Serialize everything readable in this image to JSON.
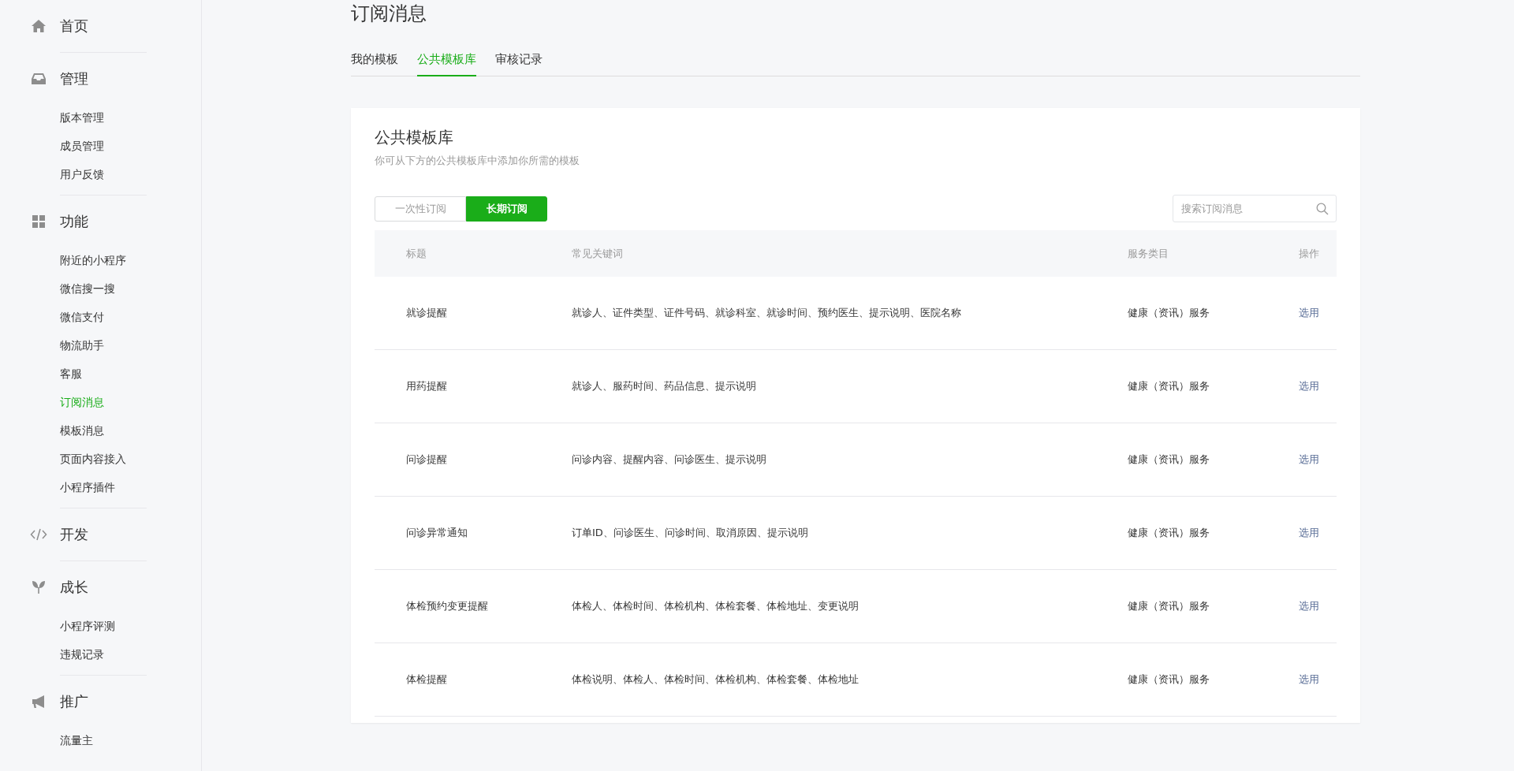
{
  "sidebar": {
    "sections": [
      {
        "title": "首页"
      },
      {
        "title": "管理",
        "items": [
          {
            "label": "版本管理",
            "selected": false
          },
          {
            "label": "成员管理",
            "selected": false
          },
          {
            "label": "用户反馈",
            "selected": false
          }
        ]
      },
      {
        "title": "功能",
        "items": [
          {
            "label": "附近的小程序",
            "selected": false
          },
          {
            "label": "微信搜一搜",
            "selected": false
          },
          {
            "label": "微信支付",
            "selected": false
          },
          {
            "label": "物流助手",
            "selected": false
          },
          {
            "label": "客服",
            "selected": false
          },
          {
            "label": "订阅消息",
            "selected": true
          },
          {
            "label": "模板消息",
            "selected": false
          },
          {
            "label": "页面内容接入",
            "selected": false
          },
          {
            "label": "小程序插件",
            "selected": false
          }
        ]
      },
      {
        "title": "开发"
      },
      {
        "title": "成长",
        "items": [
          {
            "label": "小程序评测",
            "selected": false
          },
          {
            "label": "违规记录",
            "selected": false
          }
        ]
      },
      {
        "title": "推广",
        "items": [
          {
            "label": "流量主",
            "selected": false
          }
        ]
      }
    ]
  },
  "page_title": "订阅消息",
  "tabs": [
    {
      "label": "我的模板",
      "selected": false
    },
    {
      "label": "公共模板库",
      "selected": true
    },
    {
      "label": "审核记录",
      "selected": false
    }
  ],
  "card": {
    "title": "公共模板库",
    "description": "你可从下方的公共模板库中添加你所需的模板",
    "segments": [
      {
        "label": "一次性订阅",
        "selected": false
      },
      {
        "label": "长期订阅",
        "selected": true
      }
    ],
    "search": {
      "placeholder": "搜索订阅消息"
    },
    "table": {
      "columns": [
        "标题",
        "常见关键词",
        "服务类目",
        "操作"
      ],
      "rows": [
        {
          "title": "就诊提醒",
          "keywords": "就诊人、证件类型、证件号码、就诊科室、就诊时间、预约医生、提示说明、医院名称",
          "category": "健康（资讯）服务",
          "action": "选用"
        },
        {
          "title": "用药提醒",
          "keywords": "就诊人、服药时间、药品信息、提示说明",
          "category": "健康（资讯）服务",
          "action": "选用"
        },
        {
          "title": "问诊提醒",
          "keywords": "问诊内容、提醒内容、问诊医生、提示说明",
          "category": "健康（资讯）服务",
          "action": "选用"
        },
        {
          "title": "问诊异常通知",
          "keywords": "订单ID、问诊医生、问诊时间、取消原因、提示说明",
          "category": "健康（资讯）服务",
          "action": "选用"
        },
        {
          "title": "体检预约变更提醒",
          "keywords": "体检人、体检时间、体检机构、体检套餐、体检地址、变更说明",
          "category": "健康（资讯）服务",
          "action": "选用"
        },
        {
          "title": "体检提醒",
          "keywords": "体检说明、体检人、体检时间、体检机构、体检套餐、体检地址",
          "category": "健康（资讯）服务",
          "action": "选用"
        }
      ]
    }
  }
}
